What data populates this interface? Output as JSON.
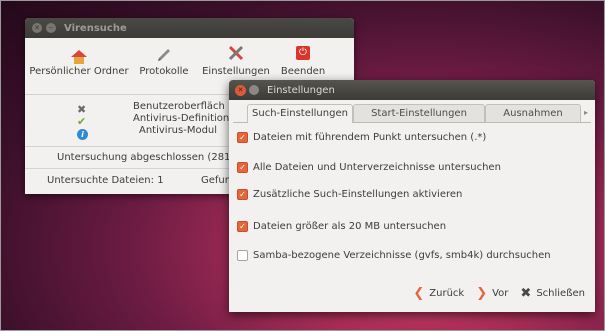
{
  "main_window": {
    "title": "Virensuche",
    "toolbar": [
      {
        "label": "Persönlicher Ordner",
        "icon": "home-icon"
      },
      {
        "label": "Protokolle",
        "icon": "pen-icon"
      },
      {
        "label": "Einstellungen",
        "icon": "tools-icon"
      },
      {
        "label": "Beenden",
        "icon": "power-icon"
      }
    ],
    "status": [
      {
        "icon": "cross-icon",
        "text": "Benutzeroberfläch"
      },
      {
        "icon": "check-icon",
        "text": "Antivirus-Definition"
      },
      {
        "icon": "info-icon",
        "text": "Antivirus-Modul"
      }
    ],
    "scan_status": "Untersuchung abgeschlossen (28116",
    "files_scanned": "Untersuchte Dateien: 1",
    "found": "Gefun"
  },
  "settings_window": {
    "title": "Einstellungen",
    "tabs": [
      "Such-Einstellungen",
      "Start-Einstellungen",
      "Ausnahmen"
    ],
    "active_tab": "Such-Einstellungen",
    "options": [
      {
        "label": "Dateien mit führendem Punkt untersuchen (.*)",
        "checked": true
      },
      {
        "label": "Alle Dateien und Unterverzeichnisse untersuchen",
        "checked": true
      },
      {
        "label": "Zusätzliche Such-Einstellungen aktivieren",
        "checked": true
      },
      {
        "label": "Dateien größer als 20 MB untersuchen",
        "checked": true
      },
      {
        "label": "Samba-bezogene Verzeichnisse (gvfs, smb4k) durchsuchen",
        "checked": false
      }
    ],
    "buttons": {
      "back": "Zurück",
      "forward": "Vor",
      "close": "Schließen"
    }
  },
  "colors": {
    "accent": "#e5663a",
    "titlebar": "#3c3b37",
    "window_bg": "#f2f1f0"
  }
}
